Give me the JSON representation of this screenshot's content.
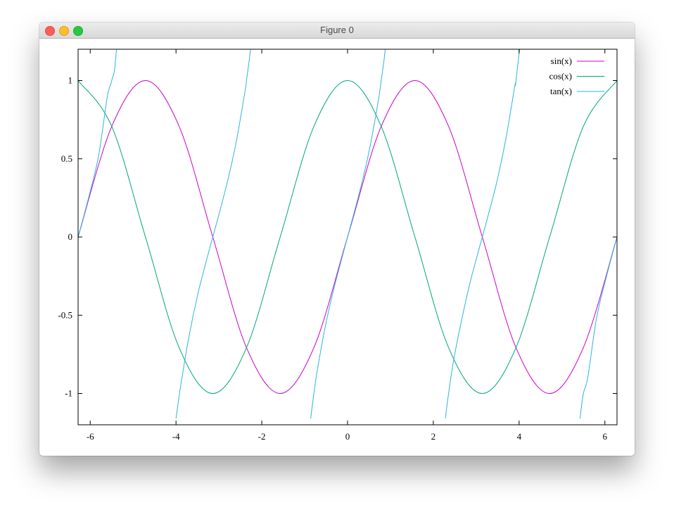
{
  "window": {
    "title": "Figure 0"
  },
  "chart_data": {
    "type": "line",
    "title": "",
    "xlabel": "",
    "ylabel": "",
    "xlim": [
      -6.283,
      6.283
    ],
    "ylim": [
      -1.2,
      1.2
    ],
    "grid": false,
    "legend_position": "top-right",
    "xticks": [
      -6,
      -4,
      -2,
      0,
      2,
      4,
      6
    ],
    "xtick_labels": [
      "-6",
      "-4",
      "-2",
      "0",
      "2",
      "4",
      "6"
    ],
    "yticks": [
      -1,
      -0.5,
      0,
      0.5,
      1
    ],
    "ytick_labels": [
      "-1",
      "-0.5",
      "0",
      "0.5",
      "1"
    ],
    "series": [
      {
        "name": "sin(x)",
        "color": "#cc00cc",
        "x": [
          -6.283,
          -5.498,
          -4.712,
          -3.927,
          -3.142,
          -2.356,
          -1.571,
          -0.785,
          0,
          0.785,
          1.571,
          2.356,
          3.142,
          3.927,
          4.712,
          5.498,
          6.283
        ],
        "y": [
          0,
          0.707,
          1,
          0.707,
          0,
          -0.707,
          -1,
          -0.707,
          0,
          0.707,
          1,
          0.707,
          0,
          -0.707,
          -1,
          -0.707,
          0
        ]
      },
      {
        "name": "cos(x)",
        "color": "#00a67d",
        "x": [
          -6.283,
          -5.498,
          -4.712,
          -3.927,
          -3.142,
          -2.356,
          -1.571,
          -0.785,
          0,
          0.785,
          1.571,
          2.356,
          3.142,
          3.927,
          4.712,
          5.498,
          6.283
        ],
        "y": [
          1,
          0.707,
          0,
          -0.707,
          -1,
          -0.707,
          0,
          0.707,
          1,
          0.707,
          0,
          -0.707,
          -1,
          -0.707,
          0,
          0.707,
          1
        ]
      },
      {
        "name": "tan(x)",
        "color": "#2cb4dc",
        "segments": [
          {
            "x": [
              -6.283,
              -6.0,
              -5.8,
              -5.6,
              -5.498,
              -5.4,
              -5.2,
              -5.02
            ],
            "y": [
              0,
              0.291,
              0.527,
              0.899,
              1,
              1.16,
              1.96,
              3.2
            ]
          },
          {
            "x": [
              -4.0,
              -3.9,
              -3.7,
              -3.5,
              -3.3,
              -3.142,
              -3.0,
              -2.8,
              -2.6,
              -2.4,
              -2.356,
              -2.2,
              -2.0
            ],
            "y": [
              -1.16,
              -0.966,
              -0.64,
              -0.375,
              -0.16,
              0,
              0.143,
              0.355,
              0.602,
              0.916,
              1,
              1.37,
              2.19
            ]
          },
          {
            "x": [
              -0.86,
              -0.785,
              -0.7,
              -0.5,
              -0.3,
              0,
              0.3,
              0.5,
              0.7,
              0.785,
              0.9,
              1.1
            ],
            "y": [
              -1.16,
              -1,
              -0.842,
              -0.546,
              -0.309,
              0,
              0.309,
              0.546,
              0.842,
              1,
              1.26,
              1.96
            ]
          },
          {
            "x": [
              2.28,
              2.356,
              2.5,
              2.8,
              3.0,
              3.142,
              3.3,
              3.5,
              3.7,
              3.9,
              3.927,
              4.1,
              4.3
            ],
            "y": [
              -1.16,
              -1,
              -0.747,
              -0.356,
              -0.143,
              0,
              0.16,
              0.375,
              0.64,
              0.966,
              1,
              1.45,
              2.28
            ]
          },
          {
            "x": [
              5.42,
              5.498,
              5.6,
              5.8,
              6.0,
              6.283
            ],
            "y": [
              -1.16,
              -1,
              -0.899,
              -0.527,
              -0.291,
              0
            ]
          }
        ]
      }
    ]
  }
}
